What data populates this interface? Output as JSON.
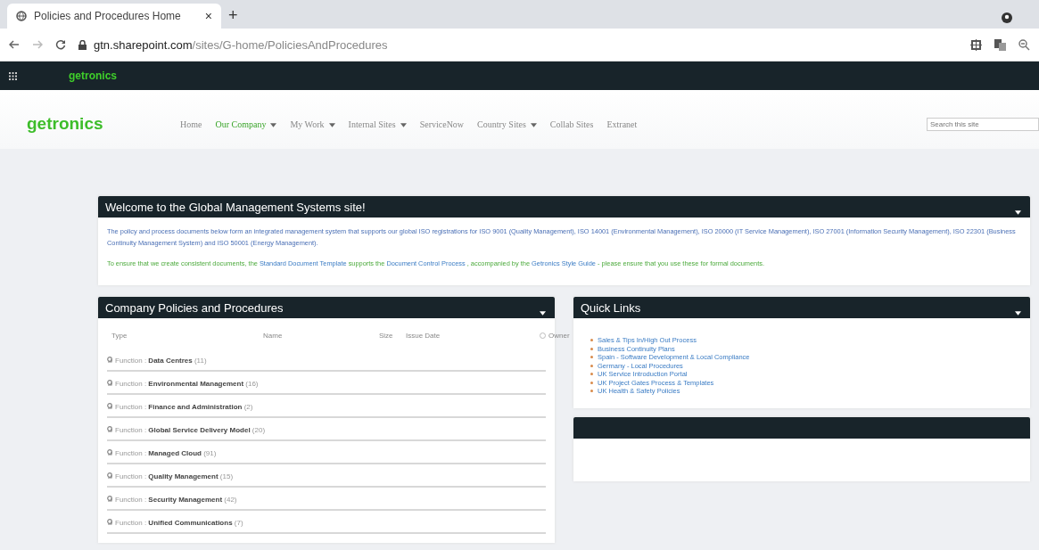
{
  "browser": {
    "tab_title": "Policies and Procedures Home",
    "close": "×",
    "new_tab": "+",
    "url_host": "gtn.sharepoint.com",
    "url_path": "/sites/G-home/PoliciesAndProcedures"
  },
  "suite_bar": {
    "logo": "getronics"
  },
  "site": {
    "logo": "getronics",
    "nav": [
      {
        "label": "Home",
        "selected": false,
        "dropdown": false
      },
      {
        "label": "Our Company",
        "selected": true,
        "dropdown": true
      },
      {
        "label": "My Work",
        "selected": false,
        "dropdown": true
      },
      {
        "label": "Internal Sites",
        "selected": false,
        "dropdown": true
      },
      {
        "label": "ServiceNow",
        "selected": false,
        "dropdown": false
      },
      {
        "label": "Country Sites",
        "selected": false,
        "dropdown": true
      },
      {
        "label": "Collab Sites",
        "selected": false,
        "dropdown": false
      },
      {
        "label": "Extranet",
        "selected": false,
        "dropdown": false
      }
    ],
    "search": {
      "placeholder": "Search this site"
    }
  },
  "welcome": {
    "title": "Welcome to the Global Management Systems site!",
    "paragraphs": [
      {
        "segments": [
          {
            "kind": "info",
            "text": "The policy and process documents below form an integrated management system that supports our global ISO registrations for ISO 9001 (Quality Management), ISO 14001 (Environmental Management), ISO 20000 (IT Service Management), ISO 27001 (Information Security Management), ISO 22301 (Business Continuity Management System) and ISO 50001 (Energy Management)."
          }
        ]
      },
      {
        "segments": [
          {
            "kind": "note",
            "text": "To ensure that we create consistent documents, the"
          },
          {
            "kind": "link",
            "text": "Standard Document Template"
          },
          {
            "kind": "note",
            "text": "supports the"
          },
          {
            "kind": "link",
            "text": "Document Control Process"
          },
          {
            "kind": "note",
            "text": ", accompanied by the"
          },
          {
            "kind": "link",
            "text": "Getronics Style Guide"
          },
          {
            "kind": "note",
            "text": "- please ensure that you use these for formal documents."
          }
        ]
      }
    ]
  },
  "policies": {
    "title": "Company Policies and Procedures",
    "columns": [
      "Type",
      "Name",
      "Size",
      "Issue Date",
      "Owner"
    ],
    "rows": [
      {
        "text": "Function : **Data Centres** (11)"
      },
      {
        "text": "Function : **Environmental Management** (16)"
      },
      {
        "text": "Function : **Finance and Administration** (2)"
      },
      {
        "text": "Function : **Global Service Delivery Model** (20)"
      },
      {
        "text": "Function : **Managed Cloud** (91)"
      },
      {
        "text": "Function : **Quality Management** (15)"
      },
      {
        "text": "Function : **Security Management** (42)"
      },
      {
        "text": "Function : **Unified Communications** (7)"
      }
    ]
  },
  "quick_links": {
    "title": "Quick Links",
    "links": [
      "Sales & Tips In/High Out Process",
      "Business Continuity Plans",
      "Spain - Software Development & Local Compliance",
      "Germany - Local Procedures",
      "UK Service Introduction Portal",
      "UK Project Gates Process & Templates",
      "UK Health & Safety Policies"
    ]
  },
  "empty_panel": {
    "kind": "empty"
  }
}
